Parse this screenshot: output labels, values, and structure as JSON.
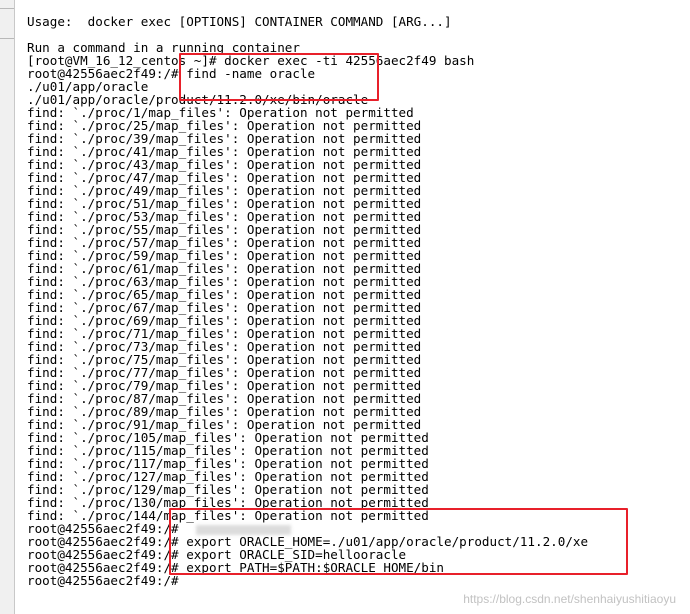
{
  "terminal": {
    "lines": [
      "Usage:  docker exec [OPTIONS] CONTAINER COMMAND [ARG...]",
      "",
      "Run a command in a running container",
      "[root@VM_16_12_centos ~]# docker exec -ti 42556aec2f49 bash",
      "root@42556aec2f49:/# find -name oracle",
      "./u01/app/oracle",
      "./u01/app/oracle/product/11.2.0/xe/bin/oracle",
      "find: `./proc/1/map_files': Operation not permitted",
      "find: `./proc/25/map_files': Operation not permitted",
      "find: `./proc/39/map_files': Operation not permitted",
      "find: `./proc/41/map_files': Operation not permitted",
      "find: `./proc/43/map_files': Operation not permitted",
      "find: `./proc/47/map_files': Operation not permitted",
      "find: `./proc/49/map_files': Operation not permitted",
      "find: `./proc/51/map_files': Operation not permitted",
      "find: `./proc/53/map_files': Operation not permitted",
      "find: `./proc/55/map_files': Operation not permitted",
      "find: `./proc/57/map_files': Operation not permitted",
      "find: `./proc/59/map_files': Operation not permitted",
      "find: `./proc/61/map_files': Operation not permitted",
      "find: `./proc/63/map_files': Operation not permitted",
      "find: `./proc/65/map_files': Operation not permitted",
      "find: `./proc/67/map_files': Operation not permitted",
      "find: `./proc/69/map_files': Operation not permitted",
      "find: `./proc/71/map_files': Operation not permitted",
      "find: `./proc/73/map_files': Operation not permitted",
      "find: `./proc/75/map_files': Operation not permitted",
      "find: `./proc/77/map_files': Operation not permitted",
      "find: `./proc/79/map_files': Operation not permitted",
      "find: `./proc/87/map_files': Operation not permitted",
      "find: `./proc/89/map_files': Operation not permitted",
      "find: `./proc/91/map_files': Operation not permitted",
      "find: `./proc/105/map_files': Operation not permitted",
      "find: `./proc/115/map_files': Operation not permitted",
      "find: `./proc/117/map_files': Operation not permitted",
      "find: `./proc/127/map_files': Operation not permitted",
      "find: `./proc/129/map_files': Operation not permitted",
      "find: `./proc/130/map_files': Operation not permitted",
      "find: `./proc/144/map_files': Operation not permitted",
      "root@42556aec2f49:/#",
      "root@42556aec2f49:/# export ORACLE_HOME=./u01/app/oracle/product/11.2.0/xe",
      "root@42556aec2f49:/# export ORACLE_SID=hellooracle",
      "root@42556aec2f49:/# export PATH=$PATH:$ORACLE_HOME/bin",
      "root@42556aec2f49:/#"
    ]
  },
  "watermark": "https://blog.csdn.net/shenhaiyushitiaoyu",
  "colors": {
    "highlight_box": "#e8202a",
    "background": "#ffffff",
    "text": "#000000"
  }
}
